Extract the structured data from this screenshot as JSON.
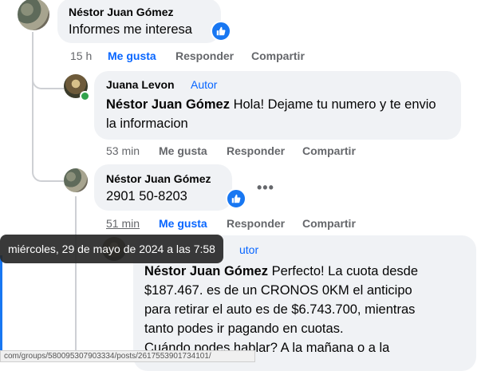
{
  "comments": [
    {
      "author": "Néstor Juan Gómez",
      "text": "Informes me interesa",
      "time": "15 h",
      "like_label": "Me gusta",
      "reply_label": "Responder",
      "share_label": "Compartir"
    },
    {
      "author": "Juana Levon",
      "badge": "Autor",
      "mention": "Néstor Juan Gómez",
      "text": "Hola! Dejame tu numero y te envio la informacion",
      "time": "53 min",
      "like_label": "Me gusta",
      "reply_label": "Responder",
      "share_label": "Compartir"
    },
    {
      "author": "Néstor Juan Gómez",
      "text": "2901 50-8203",
      "time": "51 min",
      "like_label": "Me gusta",
      "reply_label": "Responder",
      "share_label": "Compartir",
      "more_label": "•••"
    },
    {
      "badge_partial": "utor",
      "mention": "Néstor Juan Gómez",
      "lines": [
        "Perfecto! La cuota desde",
        "$187.467. es de un CRONOS 0KM el anticipo",
        "para retirar el auto es de $6.743.700, mientras",
        "tanto podes ir pagando en cuotas.",
        "Cuándo podes hablar? A la mañana o a la"
      ]
    }
  ],
  "tooltip": "miércoles, 29 de mayo de 2024 a las 7:58",
  "status_url": "com/groups/580095307903334/posts/2617553901734101/",
  "colors": {
    "link_blue": "#0866ff",
    "bubble_bg": "#f0f2f5",
    "meta_gray": "#65676b",
    "thread_line": "#ced0d4",
    "like_blue": "#1877f2"
  }
}
